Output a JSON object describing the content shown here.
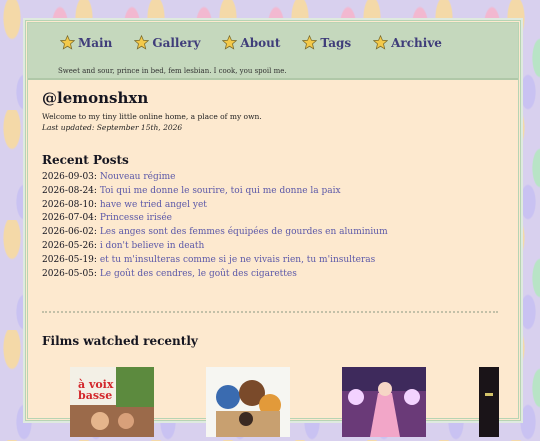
{
  "nav": {
    "items": [
      {
        "label": "Main"
      },
      {
        "label": "Gallery"
      },
      {
        "label": "About"
      },
      {
        "label": "Tags"
      },
      {
        "label": "Archive"
      }
    ],
    "tagline": "Sweet and sour, prince in bed, fem lesbian. I cook, you spoil me."
  },
  "header": {
    "title": "@lemonshxn",
    "welcome": "Welcome to my tiny little online home, a place of my own.",
    "updated": "Last updated: September 15th, 2026"
  },
  "recent": {
    "heading": "Recent Posts",
    "posts": [
      {
        "date": "2026-09-03:",
        "title": "Nouveau régime"
      },
      {
        "date": "2026-08-24:",
        "title": "Toi qui me donne le sourire, toi qui me donne la paix"
      },
      {
        "date": "2026-08-10:",
        "title": "have we tried angel yet"
      },
      {
        "date": "2026-07-04:",
        "title": "Princesse irisée"
      },
      {
        "date": "2026-06-02:",
        "title": "Les anges sont des femmes équipées de gourdes en aluminium"
      },
      {
        "date": "2026-05-26:",
        "title": "i don't believe in death"
      },
      {
        "date": "2026-05-19:",
        "title": "et tu m'insulteras comme si je ne vivais rien, tu m'insulteras"
      },
      {
        "date": "2026-05-05:",
        "title": "Le goût des cendres, le goût des cigarettes"
      }
    ]
  },
  "films": {
    "heading": "Films watched recently",
    "poster1_text": "à voix basse"
  },
  "colors": {
    "nav_bg": "#c5d8bd",
    "panel_bg": "#fde9cf",
    "link": "#5b58a8",
    "nav_text": "#3f3d7a",
    "star": "#f3c94a"
  }
}
